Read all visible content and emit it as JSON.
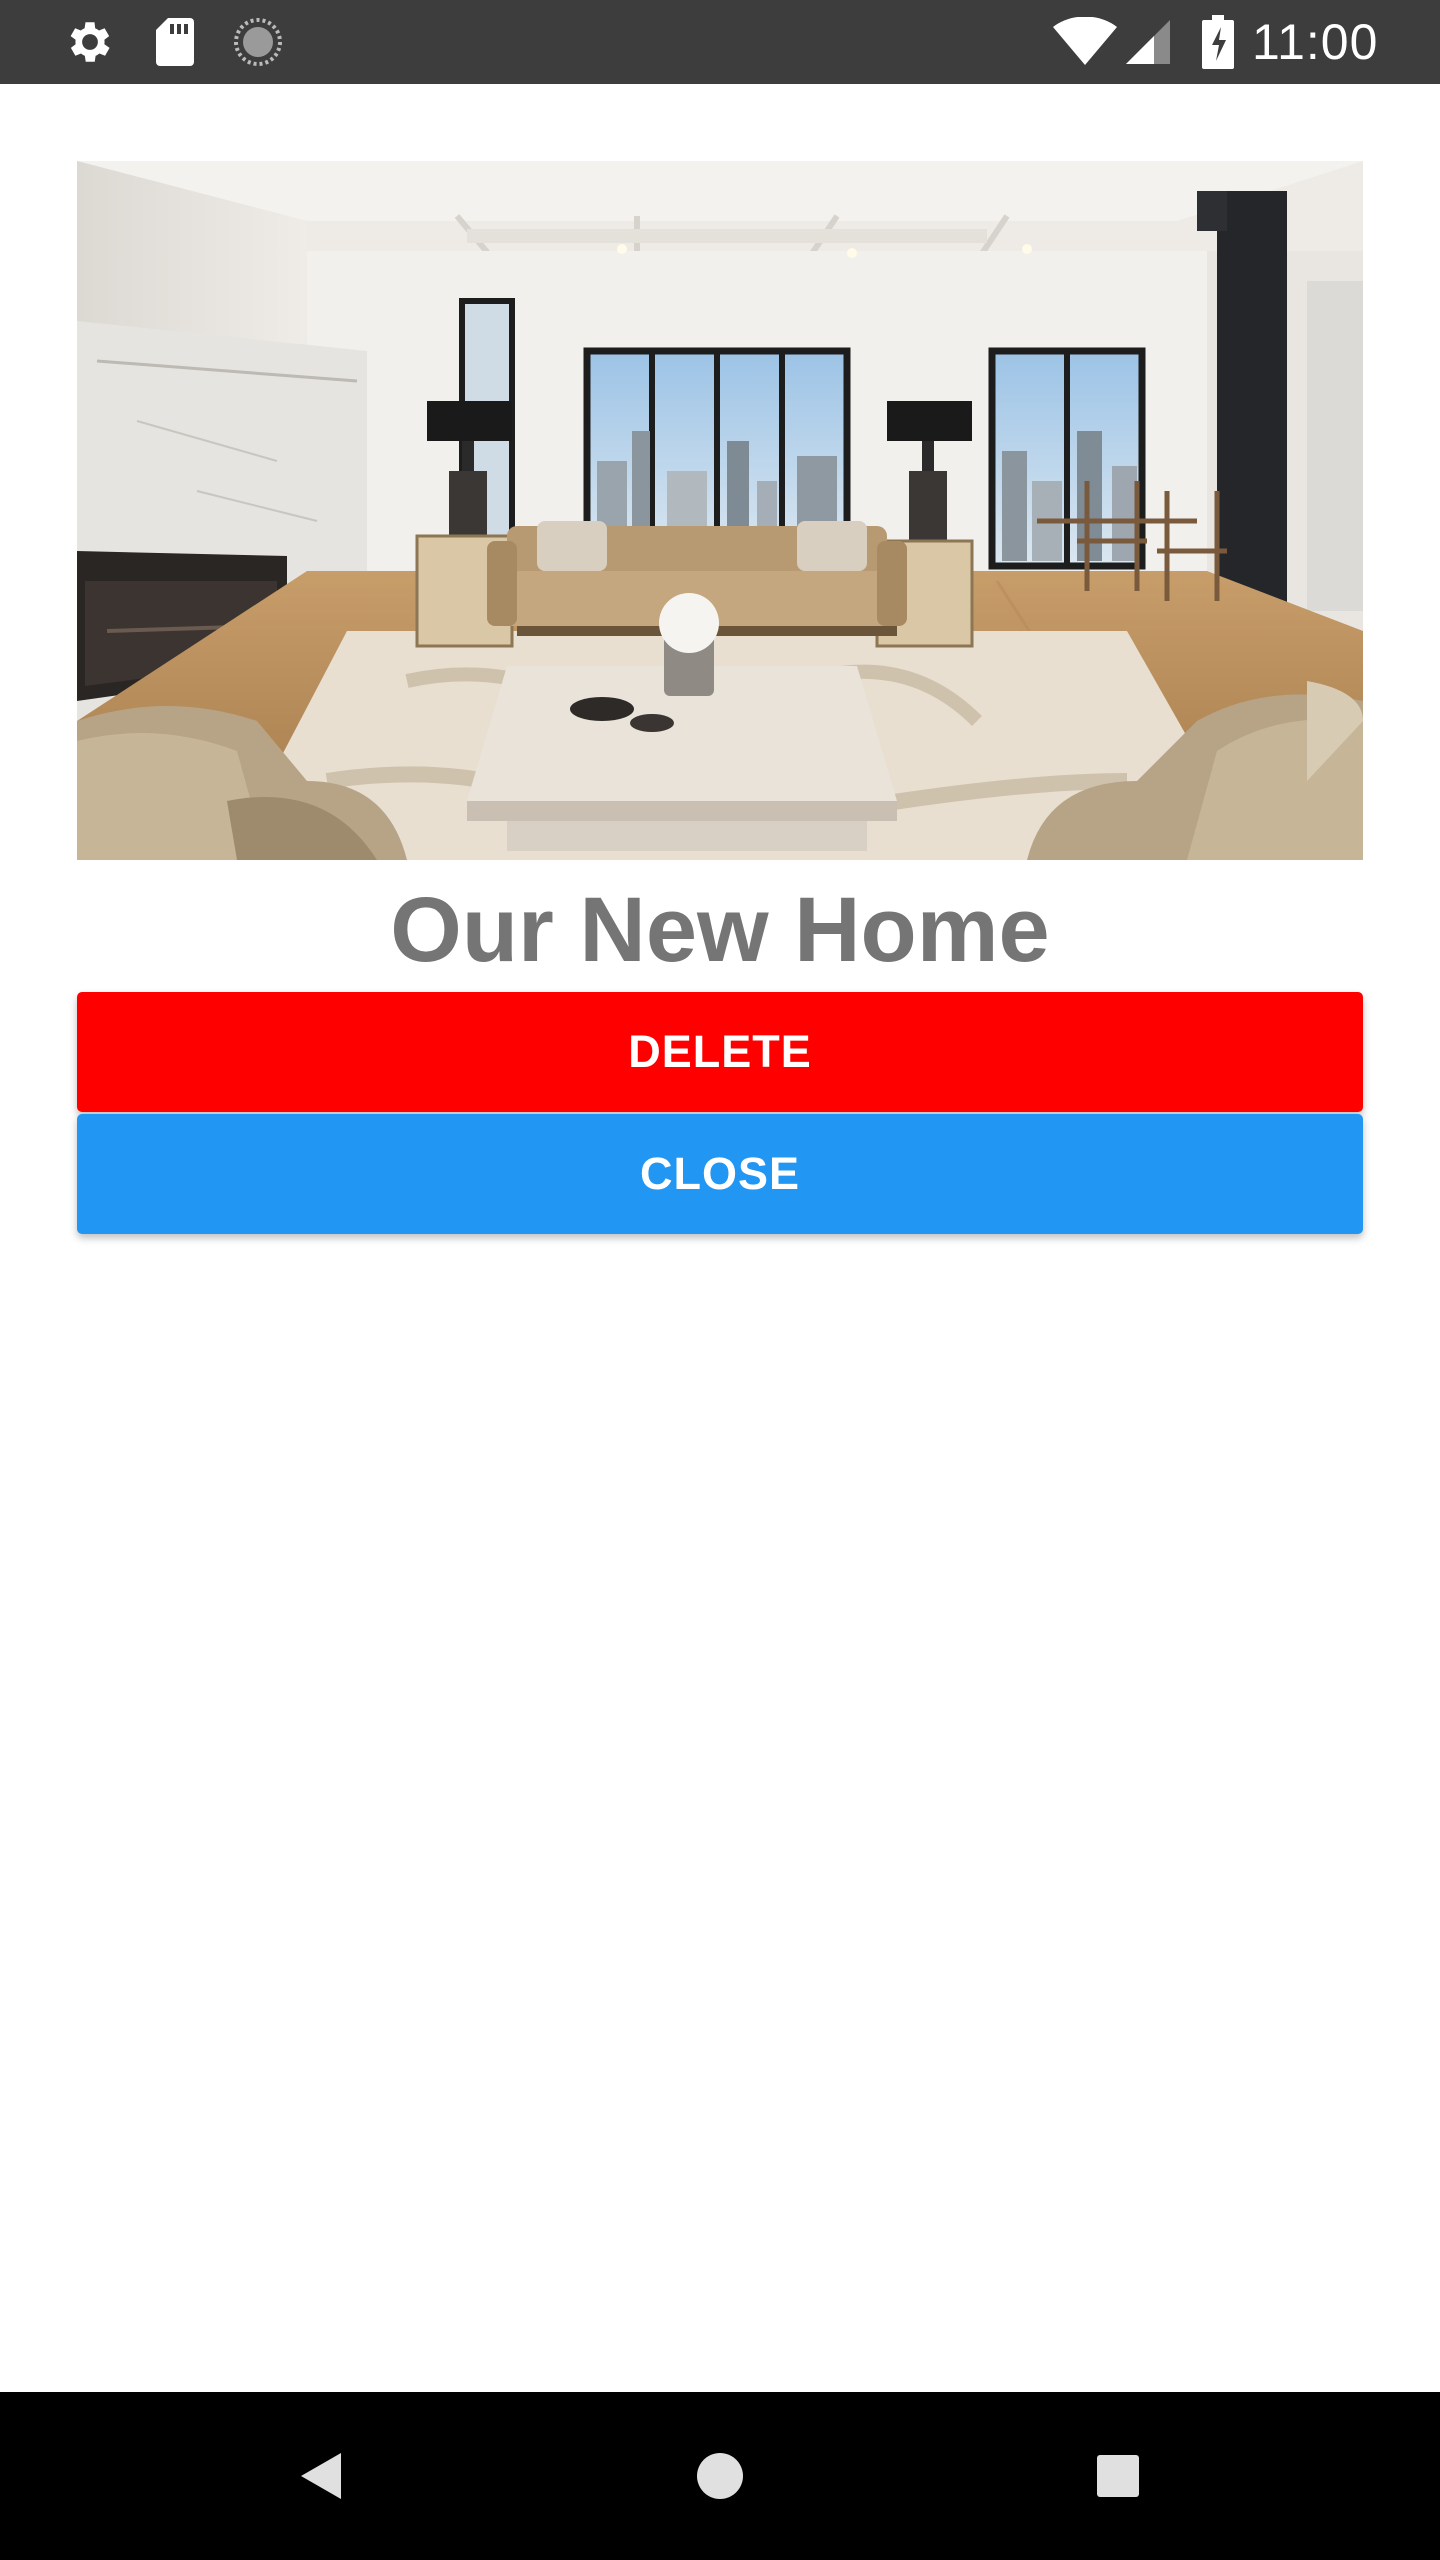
{
  "status_bar": {
    "time": "11:00",
    "icons": [
      "gear-icon",
      "sd-card-icon",
      "sync-icon",
      "wifi-icon",
      "cell-signal-icon",
      "battery-charging-icon"
    ]
  },
  "content": {
    "image": {
      "subject": "living-room-photo"
    },
    "title": "Our New Home",
    "buttons": {
      "delete_label": "DELETE",
      "close_label": "CLOSE"
    }
  },
  "colors": {
    "status_bar": "#3d3d3d",
    "title": "#757575",
    "delete": "#ff0000",
    "close": "#2196f3",
    "nav_bar": "#000000"
  },
  "nav_bar": {
    "icons": [
      "back-icon",
      "home-icon",
      "recents-icon"
    ]
  }
}
